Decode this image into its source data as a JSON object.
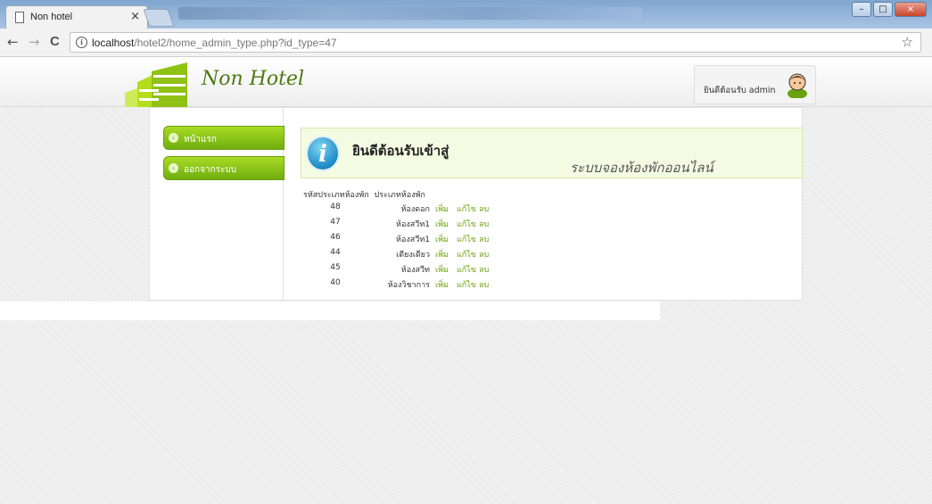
{
  "browser": {
    "tab_title": "Non hotel",
    "tab_close": "×",
    "url_host": "localhost",
    "url_path": "/hotel2/home_admin_type.php?id_type=47",
    "back": "←",
    "forward": "→",
    "reload": "C",
    "bookmark": "☆",
    "info": "i",
    "window_controls": [
      "–",
      "□",
      "×"
    ]
  },
  "header": {
    "logo_text": "Non Hotel",
    "welcome_text": "ยินดีต้อนรับ admin"
  },
  "sidebar": {
    "items": [
      {
        "label": "หน้าแรก"
      },
      {
        "label": "ออกจากระบบ"
      }
    ]
  },
  "banner": {
    "icon": "i",
    "title": "ยินดีต้อนรับเข้าสู่",
    "subtitle": "ระบบจองห้องพักออนไลน์"
  },
  "table": {
    "headers": [
      "รหัสประเภทห้องพัก",
      "ประเภทห้องพัก"
    ],
    "rows": [
      {
        "id": "48",
        "name": "ห้องดอก"
      },
      {
        "id": "47",
        "name": "ห้องสวีท1"
      },
      {
        "id": "46",
        "name": "ห้องสวีท1"
      },
      {
        "id": "44",
        "name": "เตียงเดียว"
      },
      {
        "id": "45",
        "name": "ห้องสวีท"
      },
      {
        "id": "40",
        "name": "ห้องวิชาการ"
      }
    ],
    "actions": {
      "add": "เพิ่ม",
      "edit": "แก้ไข",
      "delete": "ลบ"
    }
  }
}
